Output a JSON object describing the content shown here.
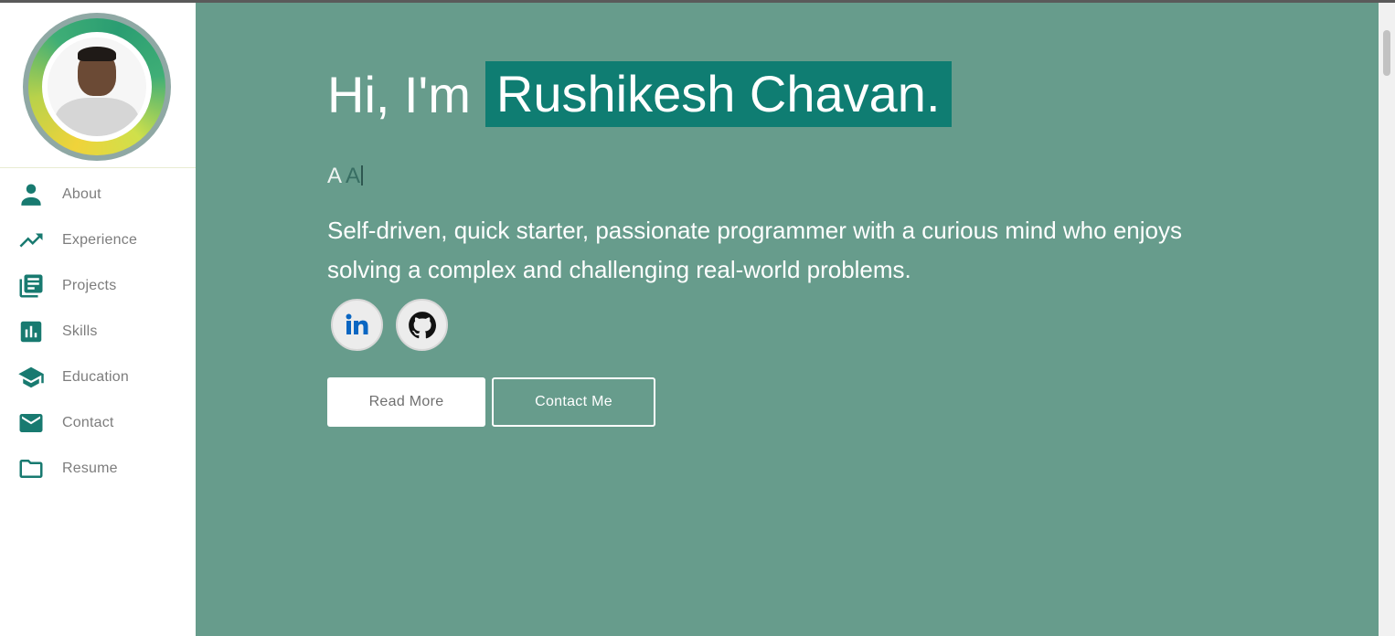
{
  "sidebar": {
    "items": [
      {
        "label": "About",
        "icon": "person-icon"
      },
      {
        "label": "Experience",
        "icon": "trending-up-icon"
      },
      {
        "label": "Projects",
        "icon": "library-books-icon"
      },
      {
        "label": "Skills",
        "icon": "bar-chart-icon"
      },
      {
        "label": "Education",
        "icon": "graduation-cap-icon"
      },
      {
        "label": "Contact",
        "icon": "mail-icon"
      },
      {
        "label": "Resume",
        "icon": "folder-icon"
      }
    ]
  },
  "hero": {
    "greeting": "Hi, I'm",
    "name": "Rushikesh Chavan.",
    "typed_prefix": "A ",
    "typed_current": "A",
    "bio": "Self-driven, quick starter, passionate programmer with a curious mind who enjoys solving a complex and challenging real-world problems."
  },
  "socials": [
    {
      "name": "linkedin",
      "icon": "linkedin-icon"
    },
    {
      "name": "github",
      "icon": "github-icon"
    }
  ],
  "buttons": {
    "read_more": "Read More",
    "contact_me": "Contact Me"
  },
  "colors": {
    "accent": "#187a70",
    "main_bg": "#679c8c",
    "name_highlight": "#0f7d72"
  }
}
